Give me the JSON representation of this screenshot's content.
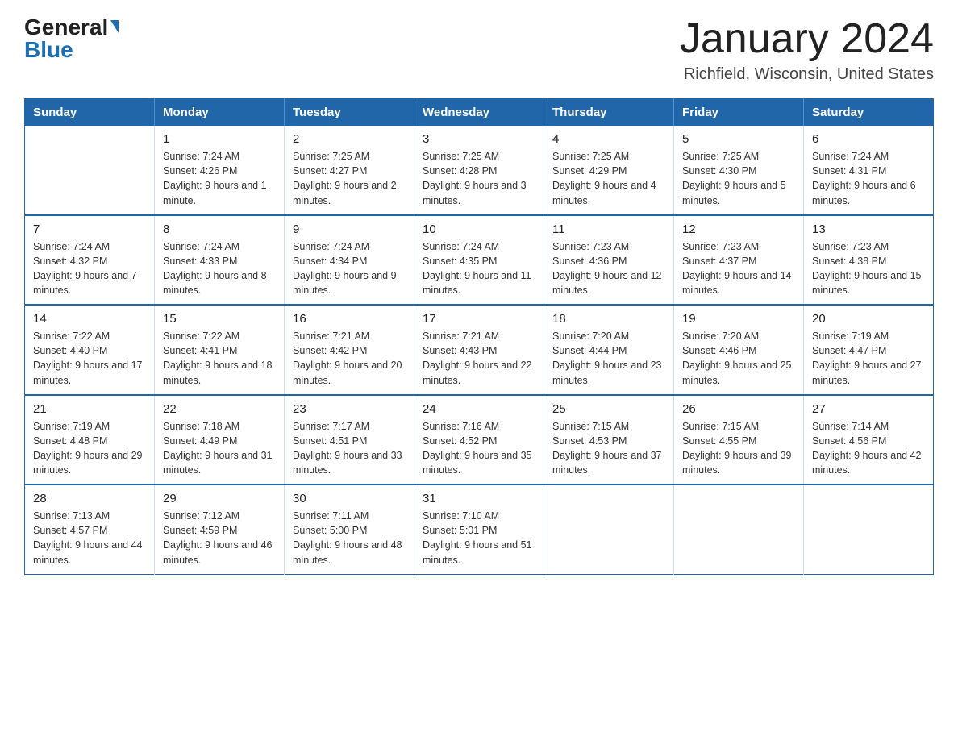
{
  "header": {
    "logo_general": "General",
    "logo_blue": "Blue",
    "month_title": "January 2024",
    "location": "Richfield, Wisconsin, United States"
  },
  "days_of_week": [
    "Sunday",
    "Monday",
    "Tuesday",
    "Wednesday",
    "Thursday",
    "Friday",
    "Saturday"
  ],
  "weeks": [
    [
      {
        "day": "",
        "sunrise": "",
        "sunset": "",
        "daylight": ""
      },
      {
        "day": "1",
        "sunrise": "Sunrise: 7:24 AM",
        "sunset": "Sunset: 4:26 PM",
        "daylight": "Daylight: 9 hours and 1 minute."
      },
      {
        "day": "2",
        "sunrise": "Sunrise: 7:25 AM",
        "sunset": "Sunset: 4:27 PM",
        "daylight": "Daylight: 9 hours and 2 minutes."
      },
      {
        "day": "3",
        "sunrise": "Sunrise: 7:25 AM",
        "sunset": "Sunset: 4:28 PM",
        "daylight": "Daylight: 9 hours and 3 minutes."
      },
      {
        "day": "4",
        "sunrise": "Sunrise: 7:25 AM",
        "sunset": "Sunset: 4:29 PM",
        "daylight": "Daylight: 9 hours and 4 minutes."
      },
      {
        "day": "5",
        "sunrise": "Sunrise: 7:25 AM",
        "sunset": "Sunset: 4:30 PM",
        "daylight": "Daylight: 9 hours and 5 minutes."
      },
      {
        "day": "6",
        "sunrise": "Sunrise: 7:24 AM",
        "sunset": "Sunset: 4:31 PM",
        "daylight": "Daylight: 9 hours and 6 minutes."
      }
    ],
    [
      {
        "day": "7",
        "sunrise": "Sunrise: 7:24 AM",
        "sunset": "Sunset: 4:32 PM",
        "daylight": "Daylight: 9 hours and 7 minutes."
      },
      {
        "day": "8",
        "sunrise": "Sunrise: 7:24 AM",
        "sunset": "Sunset: 4:33 PM",
        "daylight": "Daylight: 9 hours and 8 minutes."
      },
      {
        "day": "9",
        "sunrise": "Sunrise: 7:24 AM",
        "sunset": "Sunset: 4:34 PM",
        "daylight": "Daylight: 9 hours and 9 minutes."
      },
      {
        "day": "10",
        "sunrise": "Sunrise: 7:24 AM",
        "sunset": "Sunset: 4:35 PM",
        "daylight": "Daylight: 9 hours and 11 minutes."
      },
      {
        "day": "11",
        "sunrise": "Sunrise: 7:23 AM",
        "sunset": "Sunset: 4:36 PM",
        "daylight": "Daylight: 9 hours and 12 minutes."
      },
      {
        "day": "12",
        "sunrise": "Sunrise: 7:23 AM",
        "sunset": "Sunset: 4:37 PM",
        "daylight": "Daylight: 9 hours and 14 minutes."
      },
      {
        "day": "13",
        "sunrise": "Sunrise: 7:23 AM",
        "sunset": "Sunset: 4:38 PM",
        "daylight": "Daylight: 9 hours and 15 minutes."
      }
    ],
    [
      {
        "day": "14",
        "sunrise": "Sunrise: 7:22 AM",
        "sunset": "Sunset: 4:40 PM",
        "daylight": "Daylight: 9 hours and 17 minutes."
      },
      {
        "day": "15",
        "sunrise": "Sunrise: 7:22 AM",
        "sunset": "Sunset: 4:41 PM",
        "daylight": "Daylight: 9 hours and 18 minutes."
      },
      {
        "day": "16",
        "sunrise": "Sunrise: 7:21 AM",
        "sunset": "Sunset: 4:42 PM",
        "daylight": "Daylight: 9 hours and 20 minutes."
      },
      {
        "day": "17",
        "sunrise": "Sunrise: 7:21 AM",
        "sunset": "Sunset: 4:43 PM",
        "daylight": "Daylight: 9 hours and 22 minutes."
      },
      {
        "day": "18",
        "sunrise": "Sunrise: 7:20 AM",
        "sunset": "Sunset: 4:44 PM",
        "daylight": "Daylight: 9 hours and 23 minutes."
      },
      {
        "day": "19",
        "sunrise": "Sunrise: 7:20 AM",
        "sunset": "Sunset: 4:46 PM",
        "daylight": "Daylight: 9 hours and 25 minutes."
      },
      {
        "day": "20",
        "sunrise": "Sunrise: 7:19 AM",
        "sunset": "Sunset: 4:47 PM",
        "daylight": "Daylight: 9 hours and 27 minutes."
      }
    ],
    [
      {
        "day": "21",
        "sunrise": "Sunrise: 7:19 AM",
        "sunset": "Sunset: 4:48 PM",
        "daylight": "Daylight: 9 hours and 29 minutes."
      },
      {
        "day": "22",
        "sunrise": "Sunrise: 7:18 AM",
        "sunset": "Sunset: 4:49 PM",
        "daylight": "Daylight: 9 hours and 31 minutes."
      },
      {
        "day": "23",
        "sunrise": "Sunrise: 7:17 AM",
        "sunset": "Sunset: 4:51 PM",
        "daylight": "Daylight: 9 hours and 33 minutes."
      },
      {
        "day": "24",
        "sunrise": "Sunrise: 7:16 AM",
        "sunset": "Sunset: 4:52 PM",
        "daylight": "Daylight: 9 hours and 35 minutes."
      },
      {
        "day": "25",
        "sunrise": "Sunrise: 7:15 AM",
        "sunset": "Sunset: 4:53 PM",
        "daylight": "Daylight: 9 hours and 37 minutes."
      },
      {
        "day": "26",
        "sunrise": "Sunrise: 7:15 AM",
        "sunset": "Sunset: 4:55 PM",
        "daylight": "Daylight: 9 hours and 39 minutes."
      },
      {
        "day": "27",
        "sunrise": "Sunrise: 7:14 AM",
        "sunset": "Sunset: 4:56 PM",
        "daylight": "Daylight: 9 hours and 42 minutes."
      }
    ],
    [
      {
        "day": "28",
        "sunrise": "Sunrise: 7:13 AM",
        "sunset": "Sunset: 4:57 PM",
        "daylight": "Daylight: 9 hours and 44 minutes."
      },
      {
        "day": "29",
        "sunrise": "Sunrise: 7:12 AM",
        "sunset": "Sunset: 4:59 PM",
        "daylight": "Daylight: 9 hours and 46 minutes."
      },
      {
        "day": "30",
        "sunrise": "Sunrise: 7:11 AM",
        "sunset": "Sunset: 5:00 PM",
        "daylight": "Daylight: 9 hours and 48 minutes."
      },
      {
        "day": "31",
        "sunrise": "Sunrise: 7:10 AM",
        "sunset": "Sunset: 5:01 PM",
        "daylight": "Daylight: 9 hours and 51 minutes."
      },
      {
        "day": "",
        "sunrise": "",
        "sunset": "",
        "daylight": ""
      },
      {
        "day": "",
        "sunrise": "",
        "sunset": "",
        "daylight": ""
      },
      {
        "day": "",
        "sunrise": "",
        "sunset": "",
        "daylight": ""
      }
    ]
  ]
}
